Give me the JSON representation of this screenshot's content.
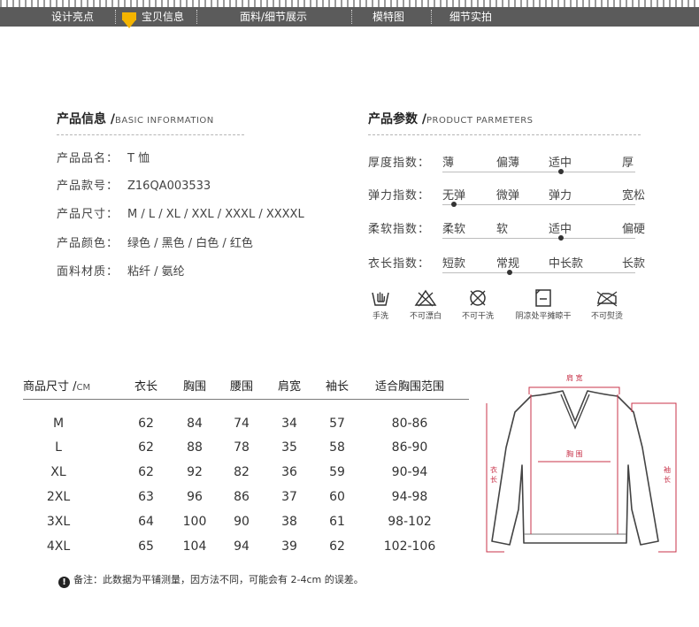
{
  "nav": {
    "items": [
      "设计亮点",
      "宝贝信息",
      "面料/细节展示",
      "模特图",
      "细节实拍"
    ],
    "active_index": 1,
    "accent": "#f4b400"
  },
  "info": {
    "title": "产品信息 /",
    "title_en": "BASIC INFORMATION",
    "rows": [
      {
        "label": "产品品名：",
        "value": "T 恤"
      },
      {
        "label": "产品款号：",
        "value": "Z16QA003533"
      },
      {
        "label": "产品尺寸：",
        "value": "M / L / XL / XXL / XXXL / XXXXL"
      },
      {
        "label": "产品颜色：",
        "value": "绿色 / 黑色 / 白色 / 红色"
      },
      {
        "label": "面料材质：",
        "value": "粘纤 / 氨纶"
      }
    ]
  },
  "params": {
    "title": "产品参数 /",
    "title_en": "PRODUCT PARMETERS",
    "rows": [
      {
        "label": "厚度指数：",
        "options": [
          "薄",
          "偏薄",
          "适中",
          "厚"
        ],
        "selected": 2
      },
      {
        "label": "弹力指数：",
        "options": [
          "无弹",
          "微弹",
          "弹力",
          "宽松"
        ],
        "selected": 0
      },
      {
        "label": "柔软指数：",
        "options": [
          "柔软",
          "软",
          "适中",
          "偏硬"
        ],
        "selected": 2
      },
      {
        "label": "衣长指数：",
        "options": [
          "短款",
          "常规",
          "中长款",
          "长款"
        ],
        "selected": 1
      }
    ]
  },
  "care": [
    {
      "icon": "hand-wash-icon",
      "label": "手洗"
    },
    {
      "icon": "no-bleach-icon",
      "label": "不可漂白"
    },
    {
      "icon": "no-dry-clean-icon",
      "label": "不可干洗"
    },
    {
      "icon": "dry-flat-shade-icon",
      "label": "阴凉处平摊晾干"
    },
    {
      "icon": "no-iron-icon",
      "label": "不可熨烫"
    }
  ],
  "size_table": {
    "header_label": "商品尺寸 /",
    "header_unit": "CM",
    "columns": [
      "衣长",
      "胸围",
      "腰围",
      "肩宽",
      "袖长",
      "适合胸围范围"
    ],
    "rows": [
      [
        "M",
        "62",
        "84",
        "74",
        "34",
        "57",
        "80-86"
      ],
      [
        "L",
        "62",
        "88",
        "78",
        "35",
        "58",
        "86-90"
      ],
      [
        "XL",
        "62",
        "92",
        "82",
        "36",
        "59",
        "90-94"
      ],
      [
        "2XL",
        "63",
        "96",
        "86",
        "37",
        "60",
        "94-98"
      ],
      [
        "3XL",
        "64",
        "100",
        "90",
        "38",
        "61",
        "98-102"
      ],
      [
        "4XL",
        "65",
        "104",
        "94",
        "39",
        "62",
        "102-106"
      ]
    ]
  },
  "note": {
    "icon": "!",
    "text": "备注：此数据为平铺测量，因方法不同，可能会有 2-4cm 的误差。"
  },
  "diagram": {
    "shoulder": "肩 宽",
    "chest": "胸 围",
    "length": "衣长",
    "sleeve": "袖长",
    "marker_color": "#c8334a"
  }
}
